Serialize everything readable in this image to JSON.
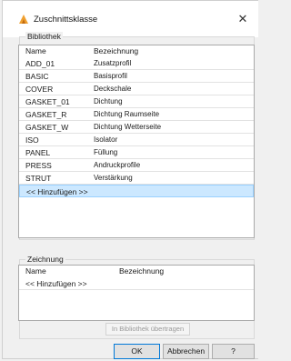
{
  "window": {
    "title": "Zuschnittsklasse"
  },
  "library": {
    "group_label": "Bibliothek",
    "columns": {
      "name": "Name",
      "description": "Bezeichnung"
    },
    "rows": [
      {
        "name": "ADD_01",
        "description": "Zusatzprofil"
      },
      {
        "name": "BASIC",
        "description": "Basisprofil"
      },
      {
        "name": "COVER",
        "description": "Deckschale"
      },
      {
        "name": "GASKET_01",
        "description": "Dichtung"
      },
      {
        "name": "GASKET_R",
        "description": "Dichtung Raumseite"
      },
      {
        "name": "GASKET_W",
        "description": "Dichtung Wetterseite"
      },
      {
        "name": "ISO",
        "description": "Isolator"
      },
      {
        "name": "PANEL",
        "description": "Füllung"
      },
      {
        "name": "PRESS",
        "description": "Andruckprofile"
      },
      {
        "name": "STRUT",
        "description": "Verstärkung"
      }
    ],
    "add_row_label": "<< Hinzufügen >>"
  },
  "drawing": {
    "group_label": "Zeichnung",
    "columns": {
      "name": "Name",
      "description": "Bezeichnung"
    },
    "add_row_label": "<< Hinzufügen >>",
    "transfer_button": "In Bibliothek übertragen"
  },
  "buttons": {
    "ok": "OK",
    "cancel": "Abbrechen",
    "help": "?"
  },
  "colors": {
    "selection": "#cce8ff",
    "icon": "#f0a030"
  }
}
